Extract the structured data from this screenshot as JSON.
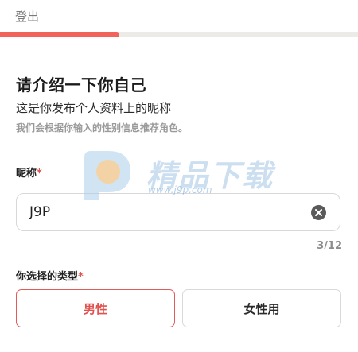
{
  "header": {
    "logout_label": "登出"
  },
  "progress": {
    "fraction": 0.333,
    "color": "#f0625a"
  },
  "intro": {
    "title": "请介绍一下你自己",
    "subtitle": "这是你发布个人资料上的昵称",
    "hint": "我们会根据你输入的性别信息推荐角色。"
  },
  "nickname": {
    "label": "昵称",
    "required_mark": "*",
    "value": "J9P",
    "counter": "3/12",
    "clear_icon": "clear-circle-icon"
  },
  "type_select": {
    "label": "你选择的类型",
    "required_mark": "*",
    "options": [
      {
        "label": "男性",
        "selected": true
      },
      {
        "label": "女性用",
        "selected": false
      }
    ]
  },
  "watermark": {
    "logo_icon": "p-logo-icon",
    "text": "精品下载",
    "url": "www.j9p.com"
  },
  "colors": {
    "accent": "#e0524f",
    "required": "#e0524f"
  }
}
